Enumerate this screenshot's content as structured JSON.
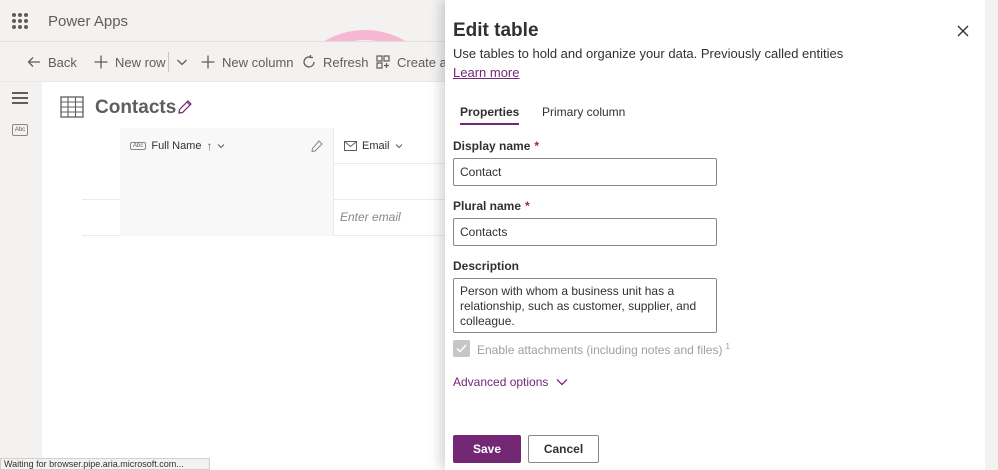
{
  "header": {
    "app_title": "Power Apps"
  },
  "commands": {
    "back": "Back",
    "new_row": "New row",
    "new_column": "New column",
    "refresh": "Refresh",
    "create_partial": "Create ar"
  },
  "main": {
    "title": "Contacts",
    "columns": {
      "full_name": "Full Name",
      "email": "Email"
    },
    "row2_email_placeholder": "Enter email"
  },
  "panel": {
    "title": "Edit table",
    "description": "Use tables to hold and organize your data. Previously called entities",
    "learn_more": "Learn more",
    "tabs": [
      {
        "label": "Properties",
        "active": true
      },
      {
        "label": "Primary column",
        "active": false
      }
    ],
    "display_name": {
      "label": "Display name",
      "required": "*",
      "value": "Contact"
    },
    "plural_name": {
      "label": "Plural name",
      "required": "*",
      "value": "Contacts"
    },
    "description_field": {
      "label": "Description",
      "value": "Person with whom a business unit has a relationship, such as customer, supplier, and colleague."
    },
    "attachments": {
      "label": "Enable attachments (including notes and files)",
      "info": "1",
      "checked": true,
      "disabled": true
    },
    "advanced_options": "Advanced options",
    "save": "Save",
    "cancel": "Cancel"
  },
  "status": {
    "text": "Waiting for browser.pipe.aria.microsoft.com..."
  },
  "colors": {
    "accent": "#742774",
    "required": "#a4262c"
  }
}
